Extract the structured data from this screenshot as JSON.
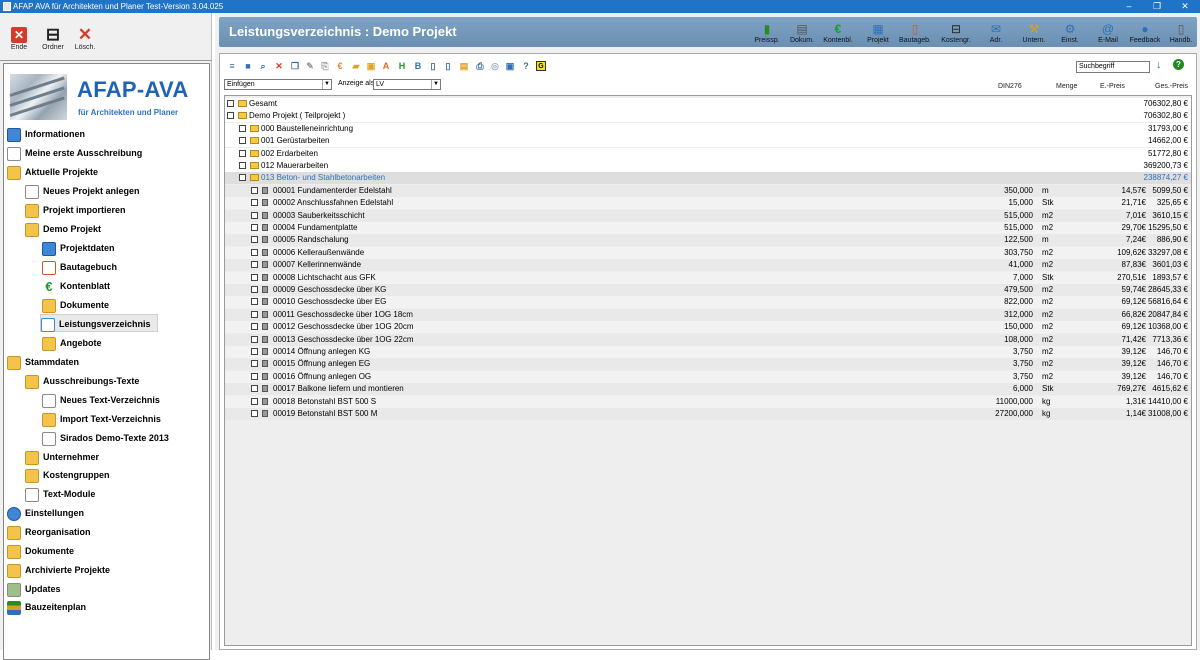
{
  "window": {
    "title": "AFAP AVA für Architekten und Planer Test-Version 3.04.025",
    "controls": {
      "minimize": "–",
      "maximize": "❐",
      "close": "✕"
    }
  },
  "left_toolbar": [
    {
      "label": "Ende",
      "icon": "exit-icon",
      "color": "#d63a2a"
    },
    {
      "label": "Ordner",
      "icon": "tree-icon",
      "color": "#222222"
    },
    {
      "label": "Lösch.",
      "icon": "delete-icon",
      "color": "#d63a2a"
    }
  ],
  "logo": {
    "title": "AFAP-AVA",
    "subtitle": "für Architekten und Planer"
  },
  "nav": [
    {
      "label": "Informationen",
      "icon": "info-icon",
      "level": 0
    },
    {
      "label": "Meine erste Ausschreibung",
      "icon": "document-icon",
      "level": 0
    },
    {
      "label": "Aktuelle Projekte",
      "icon": "folder-icon",
      "level": 0
    },
    {
      "label": "Neues Projekt anlegen",
      "icon": "new-document-icon",
      "level": 1
    },
    {
      "label": "Projekt importieren",
      "icon": "import-icon",
      "level": 1
    },
    {
      "label": "Demo Projekt",
      "icon": "folder-open-icon",
      "level": 1
    },
    {
      "label": "Projektdaten",
      "icon": "project-data-icon",
      "level": 2
    },
    {
      "label": "Bautagebuch",
      "icon": "book-icon",
      "level": 2
    },
    {
      "label": "Kontenblatt",
      "icon": "euro-icon",
      "level": 2
    },
    {
      "label": "Dokumente",
      "icon": "folder-open-icon",
      "level": 2
    },
    {
      "label": "Leistungsverzeichnis",
      "icon": "list-icon",
      "level": 2,
      "selected": true
    },
    {
      "label": "Angebote",
      "icon": "folder-icon",
      "level": 2
    },
    {
      "label": "Stammdaten",
      "icon": "folder-icon",
      "level": 0
    },
    {
      "label": "Ausschreibungs-Texte",
      "icon": "folder-icon",
      "level": 1
    },
    {
      "label": "Neues Text-Verzeichnis",
      "icon": "new-document-icon",
      "level": 2
    },
    {
      "label": "Import Text-Verzeichnis",
      "icon": "import-icon",
      "level": 2
    },
    {
      "label": "Sirados Demo-Texte 2013",
      "icon": "document-icon",
      "level": 2
    },
    {
      "label": "Unternehmer",
      "icon": "contractor-icon",
      "level": 1
    },
    {
      "label": "Kostengruppen",
      "icon": "folder-icon",
      "level": 1
    },
    {
      "label": "Text-Module",
      "icon": "document-icon",
      "level": 1
    },
    {
      "label": "Einstellungen",
      "icon": "gear-icon",
      "level": 0
    },
    {
      "label": "Reorganisation",
      "icon": "folder-icon",
      "level": 0
    },
    {
      "label": "Dokumente",
      "icon": "folder-open-icon",
      "level": 0
    },
    {
      "label": "Archivierte Projekte",
      "icon": "folder-icon",
      "level": 0
    },
    {
      "label": "Updates",
      "icon": "update-icon",
      "level": 0
    },
    {
      "label": "Bauzeitenplan",
      "icon": "schedule-icon",
      "level": 0
    }
  ],
  "header": {
    "title": "Leistungsverzeichnis : Demo Projekt",
    "buttons": [
      {
        "label": "Preissp.",
        "icon": "chart-icon"
      },
      {
        "label": "Dokum.",
        "icon": "document-icon"
      },
      {
        "label": "Kontenbl.",
        "icon": "euro-icon"
      },
      {
        "label": "Projekt",
        "icon": "project-icon"
      },
      {
        "label": "Bautageb.",
        "icon": "book-icon"
      },
      {
        "label": "Kostengr.",
        "icon": "tree-icon"
      },
      {
        "label": "Adr.",
        "icon": "address-icon"
      },
      {
        "label": "Untern.",
        "icon": "contractor-icon"
      },
      {
        "label": "Einst.",
        "icon": "gear-icon"
      },
      {
        "label": "E-Mail",
        "icon": "email-icon"
      },
      {
        "label": "Feedback",
        "icon": "feedback-icon"
      },
      {
        "label": "Handb.",
        "icon": "manual-icon"
      }
    ]
  },
  "toolbar": {
    "icons": [
      "list-icon",
      "save-icon",
      "search-icon",
      "delete-icon",
      "copy-icon",
      "edit-icon",
      "paste-icon",
      "euro-icon",
      "folder-icon",
      "duplicate-icon",
      "text-a-icon",
      "text-h-icon",
      "text-b-icon",
      "page-icon",
      "pages-icon",
      "notes-icon",
      "print-icon",
      "settings-icon",
      "disk-icon",
      "help-icon",
      "g-icon"
    ],
    "insert_select": "Einfügen",
    "view_label": "Anzeige als",
    "view_select": "LV",
    "search_placeholder": "Suchbegriff"
  },
  "columns": {
    "din": "DIN276",
    "menge": "Menge",
    "ep": "E.-Preis",
    "gp": "Ges.-Preis"
  },
  "rows": [
    {
      "level": 0,
      "type": "folder",
      "text": "Gesamt",
      "gp": "706302,80 €"
    },
    {
      "level": 0,
      "type": "folder",
      "text": "Demo Projekt ( Teilprojekt )",
      "gp": "706302,80 €"
    },
    {
      "level": 1,
      "type": "folder",
      "text": "000 Baustelleneinrichtung",
      "gp": "31793,00 €"
    },
    {
      "level": 1,
      "type": "folder",
      "text": "001 Gerüstarbeiten",
      "gp": "14662,00 €"
    },
    {
      "level": 1,
      "type": "folder",
      "text": "002 Erdarbeiten",
      "gp": "51772,80 €"
    },
    {
      "level": 1,
      "type": "folder",
      "text": "012 Mauerarbeiten",
      "gp": "369200,73 €"
    },
    {
      "level": 1,
      "type": "folder",
      "text": "013 Beton- und Stahlbetonarbeiten",
      "gp": "238874,27 €",
      "highlight": true
    },
    {
      "level": 2,
      "type": "pos",
      "text": "00001 Fundamenterder Edelstahl",
      "menge": "350,000",
      "unit": "m",
      "ep": "14,57€",
      "gp": "5099,50 €"
    },
    {
      "level": 2,
      "type": "pos",
      "text": "00002 Anschlussfahnen Edelstahl",
      "menge": "15,000",
      "unit": "Stk",
      "ep": "21,71€",
      "gp": "325,65 €"
    },
    {
      "level": 2,
      "type": "pos",
      "text": "00003 Sauberkeitsschicht",
      "menge": "515,000",
      "unit": "m2",
      "ep": "7,01€",
      "gp": "3610,15 €"
    },
    {
      "level": 2,
      "type": "pos",
      "text": "00004 Fundamentplatte",
      "menge": "515,000",
      "unit": "m2",
      "ep": "29,70€",
      "gp": "15295,50 €"
    },
    {
      "level": 2,
      "type": "pos",
      "text": "00005 Randschalung",
      "menge": "122,500",
      "unit": "m",
      "ep": "7,24€",
      "gp": "886,90 €"
    },
    {
      "level": 2,
      "type": "pos",
      "text": "00006 Kelleraußenwände",
      "menge": "303,750",
      "unit": "m2",
      "ep": "109,62€",
      "gp": "33297,08 €"
    },
    {
      "level": 2,
      "type": "pos",
      "text": "00007 Kellerinnenwände",
      "menge": "41,000",
      "unit": "m2",
      "ep": "87,83€",
      "gp": "3601,03 €"
    },
    {
      "level": 2,
      "type": "pos",
      "text": "00008 Lichtschacht aus GFK",
      "menge": "7,000",
      "unit": "Stk",
      "ep": "270,51€",
      "gp": "1893,57 €"
    },
    {
      "level": 2,
      "type": "pos",
      "text": "00009 Geschossdecke über KG",
      "menge": "479,500",
      "unit": "m2",
      "ep": "59,74€",
      "gp": "28645,33 €"
    },
    {
      "level": 2,
      "type": "pos",
      "text": "00010 Geschossdecke über EG",
      "menge": "822,000",
      "unit": "m2",
      "ep": "69,12€",
      "gp": "56816,64 €"
    },
    {
      "level": 2,
      "type": "pos",
      "text": "00011 Geschossdecke über 1OG 18cm",
      "menge": "312,000",
      "unit": "m2",
      "ep": "66,82€",
      "gp": "20847,84 €"
    },
    {
      "level": 2,
      "type": "pos",
      "text": "00012 Geschossdecke über 1OG 20cm",
      "menge": "150,000",
      "unit": "m2",
      "ep": "69,12€",
      "gp": "10368,00 €"
    },
    {
      "level": 2,
      "type": "pos",
      "text": "00013 Geschossdecke über 1OG 22cm",
      "menge": "108,000",
      "unit": "m2",
      "ep": "71,42€",
      "gp": "7713,36 €"
    },
    {
      "level": 2,
      "type": "pos",
      "text": "00014 Öffnung anlegen KG",
      "menge": "3,750",
      "unit": "m2",
      "ep": "39,12€",
      "gp": "146,70 €"
    },
    {
      "level": 2,
      "type": "pos",
      "text": "00015 Öffnung anlegen EG",
      "menge": "3,750",
      "unit": "m2",
      "ep": "39,12€",
      "gp": "146,70 €"
    },
    {
      "level": 2,
      "type": "pos",
      "text": "00016 Öffnung anlegen OG",
      "menge": "3,750",
      "unit": "m2",
      "ep": "39,12€",
      "gp": "146,70 €"
    },
    {
      "level": 2,
      "type": "pos",
      "text": "00017 Balkone liefern und montieren",
      "menge": "6,000",
      "unit": "Stk",
      "ep": "769,27€",
      "gp": "4615,62 €"
    },
    {
      "level": 2,
      "type": "pos",
      "text": "00018 Betonstahl BST 500 S",
      "menge": "11000,000",
      "unit": "kg",
      "ep": "1,31€",
      "gp": "14410,00 €"
    },
    {
      "level": 2,
      "type": "pos",
      "text": "00019 Betonstahl BST 500 M",
      "menge": "27200,000",
      "unit": "kg",
      "ep": "1,14€",
      "gp": "31008,00 €"
    }
  ]
}
